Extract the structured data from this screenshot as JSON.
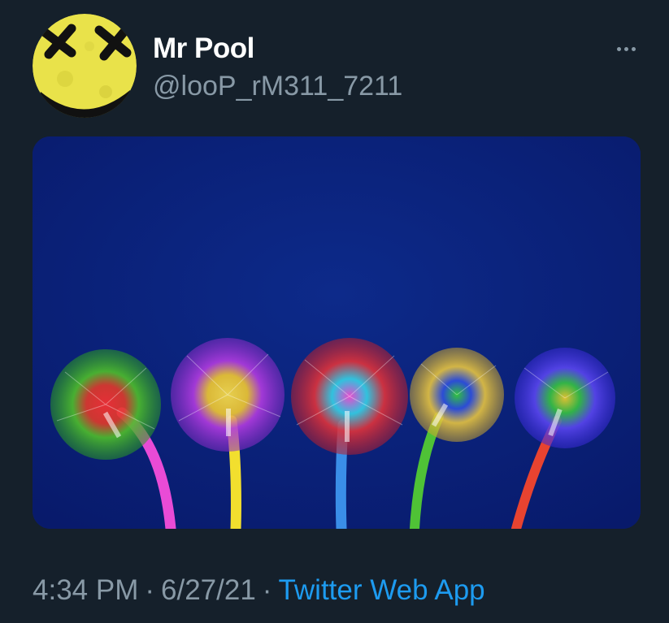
{
  "tweet": {
    "display_name": "Mr Pool",
    "handle": "@looP_rM311_7211",
    "time": "4:34 PM",
    "separator": "·",
    "date": "6/27/21",
    "source": "Twitter Web App"
  },
  "icons": {
    "more": "more-horizontal-icon"
  },
  "colors": {
    "background": "#15202b",
    "name": "#ffffff",
    "secondary_text": "#8899a6",
    "link": "#1d9bf0",
    "media_background": "#0b1f7a"
  }
}
